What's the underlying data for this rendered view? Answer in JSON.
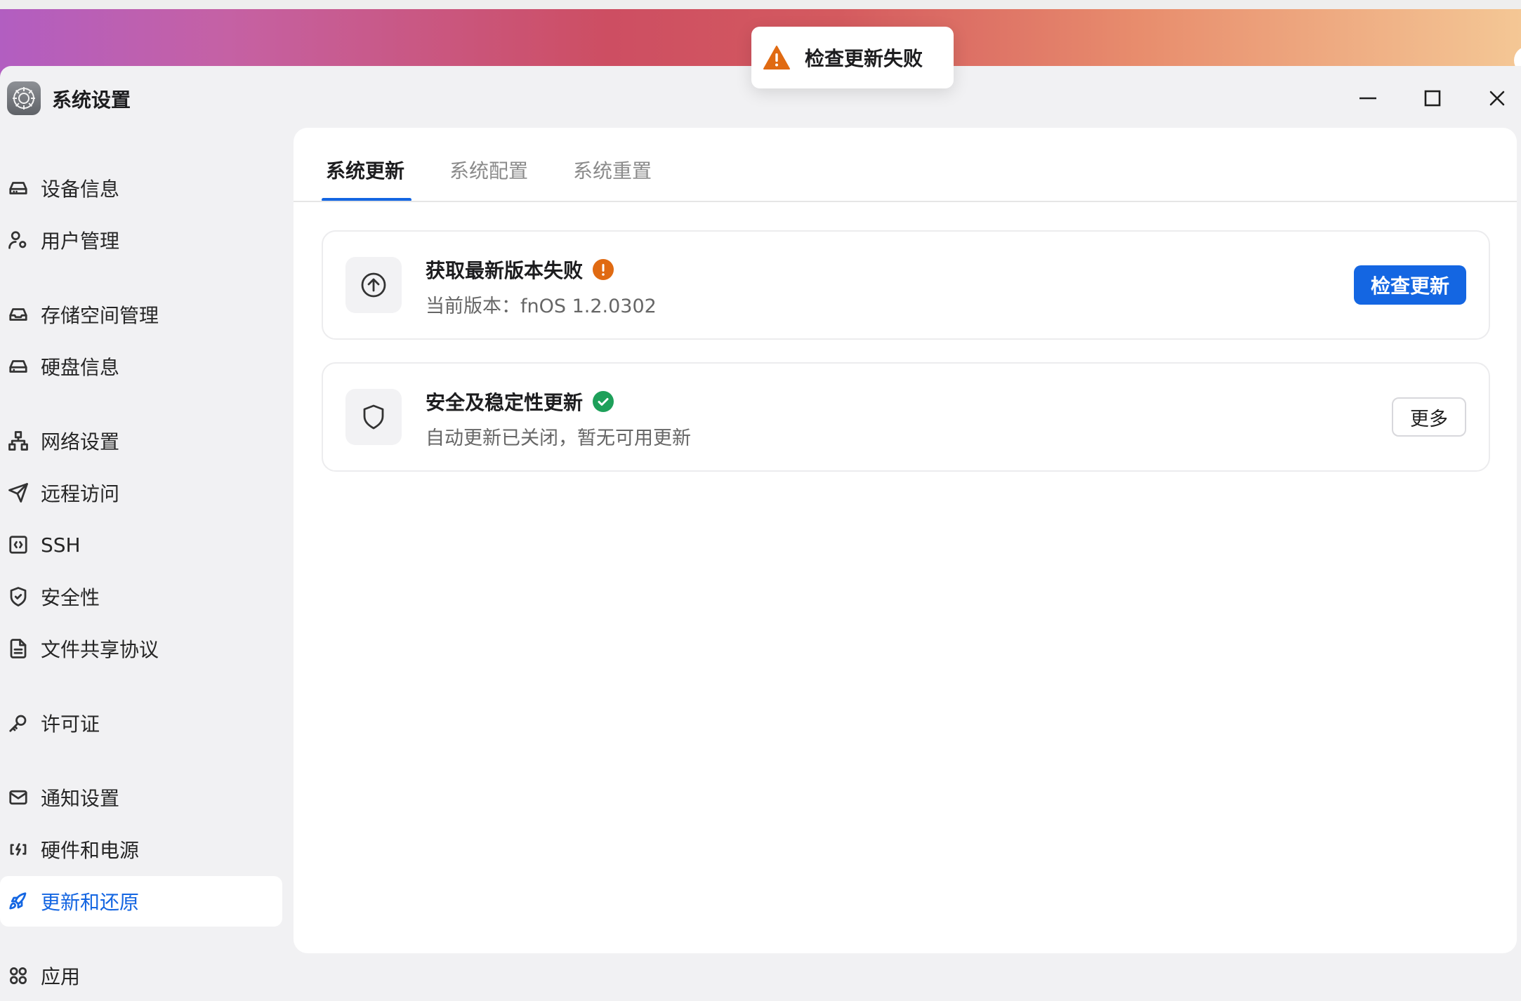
{
  "window": {
    "title": "系统设置"
  },
  "toast": {
    "text": "检查更新失败",
    "icon": "warning-triangle-icon",
    "color": "#e06a12"
  },
  "sidebar": {
    "items": [
      {
        "label": "设备信息",
        "icon": "device-drive-icon"
      },
      {
        "label": "用户管理",
        "icon": "user-settings-icon"
      },
      {
        "label": "存储空间管理",
        "icon": "storage-inbox-icon"
      },
      {
        "label": "硬盘信息",
        "icon": "hard-disk-icon"
      },
      {
        "label": "网络设置",
        "icon": "network-icon"
      },
      {
        "label": "远程访问",
        "icon": "send-icon"
      },
      {
        "label": "SSH",
        "icon": "terminal-code-icon"
      },
      {
        "label": "安全性",
        "icon": "shield-check-icon"
      },
      {
        "label": "文件共享协议",
        "icon": "file-text-icon"
      },
      {
        "label": "许可证",
        "icon": "key-icon"
      },
      {
        "label": "通知设置",
        "icon": "mail-icon"
      },
      {
        "label": "硬件和电源",
        "icon": "power-plug-icon"
      },
      {
        "label": "更新和还原",
        "icon": "rocket-icon",
        "active": true
      },
      {
        "label": "应用",
        "icon": "apps-grid-icon"
      }
    ]
  },
  "tabs": [
    {
      "label": "系统更新",
      "active": true
    },
    {
      "label": "系统配置"
    },
    {
      "label": "系统重置"
    }
  ],
  "cards": {
    "version": {
      "title": "获取最新版本失败",
      "subtitle": "当前版本：fnOS 1.2.0302",
      "status": "warning",
      "status_color": "#e06a12",
      "button": "检查更新"
    },
    "security": {
      "title": "安全及稳定性更新",
      "subtitle": "自动更新已关闭，暂无可用更新",
      "status": "ok",
      "status_color": "#1ea05a",
      "button": "更多"
    }
  },
  "colors": {
    "accent": "#1466e2"
  }
}
